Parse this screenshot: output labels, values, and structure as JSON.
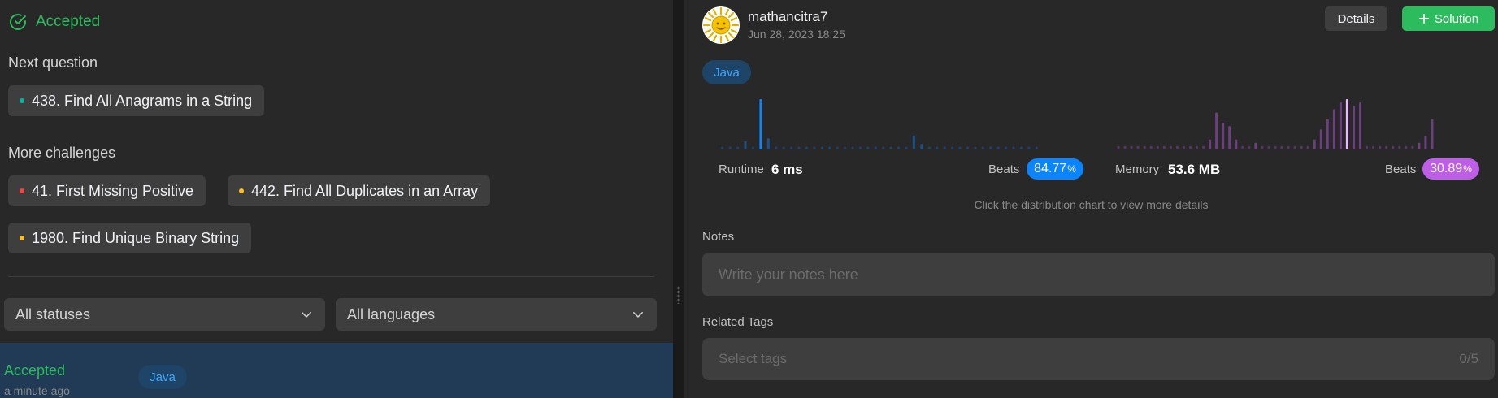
{
  "left": {
    "status": "Accepted",
    "next_label": "Next question",
    "next_question": {
      "title": "438. Find All Anagrams in a String",
      "dot_color": "#00b8a3"
    },
    "more_label": "More challenges",
    "challenges": [
      {
        "title": "41. First Missing Positive",
        "dot_color": "#ef4743"
      },
      {
        "title": "442. Find All Duplicates in an Array",
        "dot_color": "#ffc01e"
      },
      {
        "title": "1980. Find Unique Binary String",
        "dot_color": "#ffc01e"
      }
    ],
    "filters": {
      "status": "All statuses",
      "language": "All languages"
    },
    "submission": {
      "status": "Accepted",
      "time": "a minute ago",
      "language": "Java"
    }
  },
  "right": {
    "user": {
      "name": "mathancitra7",
      "date": "Jun 28, 2023 18:25"
    },
    "details_button": "Details",
    "solution_button": "Solution",
    "language": "Java",
    "runtime": {
      "label": "Runtime",
      "value": "6 ms",
      "beats_label": "Beats",
      "beats": "84.77",
      "beats_unit": "%",
      "color": "#0a84ff",
      "bars": [
        1,
        1,
        1,
        3,
        1,
        18,
        4,
        1,
        1,
        1,
        1,
        1,
        1,
        1,
        1,
        1,
        1,
        1,
        1,
        1,
        1,
        1,
        1,
        1,
        1,
        5,
        2,
        1,
        1,
        1,
        1,
        1,
        1,
        1,
        1,
        1,
        1,
        1,
        1,
        1,
        1,
        1
      ],
      "highlight_index": 5
    },
    "memory": {
      "label": "Memory",
      "value": "53.6 MB",
      "beats_label": "Beats",
      "beats": "30.89",
      "beats_unit": "%",
      "color": "#be5de6",
      "bars": [
        1,
        1,
        1,
        1,
        1,
        1,
        1,
        1,
        1,
        1,
        1,
        1,
        1,
        1,
        3,
        11,
        8,
        7,
        3,
        1,
        1,
        2,
        1,
        1,
        1,
        1,
        1,
        1,
        1,
        1,
        3,
        6,
        9,
        12,
        14,
        15,
        13,
        14,
        1,
        1,
        1,
        1,
        1,
        1,
        1,
        1,
        2,
        4,
        9
      ],
      "highlight_index": 35
    },
    "chart_hint": "Click the distribution chart to view more details",
    "notes_label": "Notes",
    "notes_placeholder": "Write your notes here",
    "tags_label": "Related Tags",
    "tags_placeholder": "Select tags",
    "tags_count": "0/5"
  }
}
